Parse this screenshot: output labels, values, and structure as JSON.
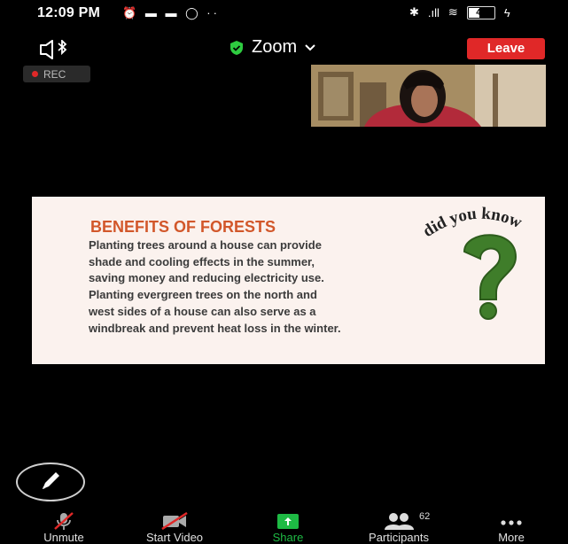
{
  "status_bar": {
    "time": "12:09 PM",
    "left_icons": [
      "alarm-off-icon",
      "video-call-icon",
      "camera-icon",
      "record-icon"
    ],
    "right_icons": [
      "bluetooth-icon",
      "signal-icon",
      "wifi-icon",
      "battery-icon",
      "charging-icon"
    ],
    "battery": "40"
  },
  "top_bar": {
    "meeting_title": "Zoom",
    "leave_label": "Leave",
    "rec_label": "REC",
    "accent": "#e02828",
    "shield_color": "#2ecc40"
  },
  "slide": {
    "title": "BENEFITS OF FORESTS",
    "lines": [
      "Planting trees around a house can provide",
      "shade and cooling effects in the summer,",
      "saving money and reducing electricity use.",
      "Planting evergreen trees on the north and",
      "west sides of a house can also serve as a",
      "windbreak and prevent heat loss in the winter."
    ],
    "did_you_know": "did you know",
    "title_color": "#d2572a"
  },
  "toolbar": {
    "unmute": "Unmute",
    "start_video": "Start Video",
    "share": "Share",
    "participants": "Participants",
    "participants_count": "62",
    "more": "More",
    "share_color": "#1eba44"
  }
}
